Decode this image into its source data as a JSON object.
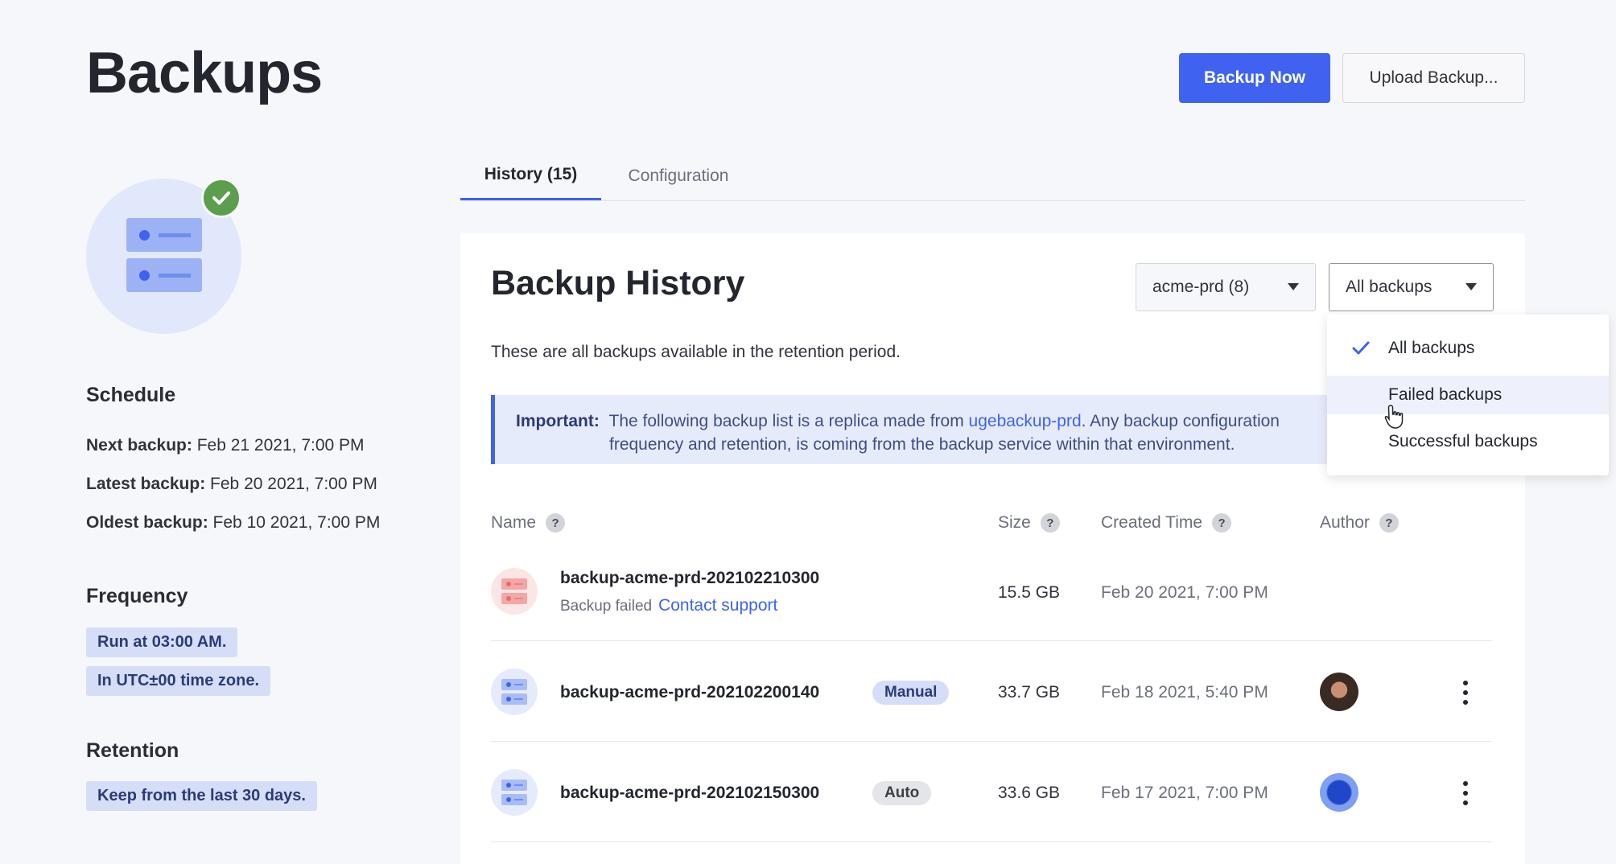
{
  "page": {
    "title": "Backups"
  },
  "actions": {
    "backup_now": "Backup Now",
    "upload": "Upload Backup..."
  },
  "sidebar": {
    "schedule": {
      "heading": "Schedule",
      "items": [
        {
          "label": "Next backup:",
          "value": "Feb 21 2021, 7:00 PM"
        },
        {
          "label": "Latest backup:",
          "value": "Feb 20 2021, 7:00 PM"
        },
        {
          "label": "Oldest backup:",
          "value": "Feb 10 2021, 7:00 PM"
        }
      ]
    },
    "frequency": {
      "heading": "Frequency",
      "pills": [
        "Run at 03:00 AM.",
        "In UTC±00 time zone."
      ]
    },
    "retention": {
      "heading": "Retention",
      "pills": [
        "Keep from the last 30 days."
      ]
    }
  },
  "tabs": [
    {
      "label": "History (15)",
      "active": true
    },
    {
      "label": "Configuration",
      "active": false
    }
  ],
  "history": {
    "title": "Backup History",
    "env_select": "acme-prd (8)",
    "filter_select": "All backups",
    "description": "These are all backups available in the retention period.",
    "notice": {
      "label": "Important:",
      "text_before": "The following backup list is a replica made from ",
      "link": "ugebackup-prd",
      "text_after": ". Any backup configuration",
      "line2": "frequency and retention, is coming from the backup service within that environment."
    },
    "columns": [
      "Name",
      "Size",
      "Created Time",
      "Author"
    ],
    "rows": [
      {
        "name": "backup-acme-prd-202102210300",
        "status": "Backup failed",
        "status_link": "Contact support",
        "badge": "",
        "size": "15.5 GB",
        "created": "Feb 20 2021, 7:00 PM"
      },
      {
        "name": "backup-acme-prd-202102200140",
        "badge": "Manual",
        "size": "33.7 GB",
        "created": "Feb 18 2021, 5:40 PM"
      },
      {
        "name": "backup-acme-prd-202102150300",
        "badge": "Auto",
        "size": "33.6 GB",
        "created": "Feb 17 2021, 7:00 PM"
      }
    ]
  },
  "filter_menu": {
    "options": [
      "All backups",
      "Failed backups",
      "Successful backups"
    ],
    "selected": "All backups",
    "hovered": "Failed backups"
  },
  "colors": {
    "accent": "#3f63f0",
    "success": "#5a9e4e",
    "failed": "#e26d6d"
  }
}
